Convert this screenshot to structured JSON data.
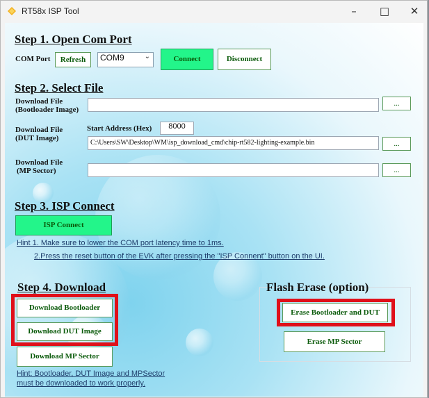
{
  "window": {
    "title": "RT58x ISP Tool"
  },
  "step1": {
    "heading": "Step 1. Open Com Port",
    "com_label": "COM Port",
    "refresh_label": "Refresh",
    "com_value": "COM9",
    "connect_label": "Connect",
    "disconnect_label": "Disconnect"
  },
  "step2": {
    "heading": "Step 2. Select File",
    "bootloader_label_1": "Download File",
    "bootloader_label_2": "(Bootloader Image)",
    "dut_label_1": "Download File",
    "dut_label_2": "(DUT Image)",
    "mp_label_1": "Download File",
    "mp_label_2": "(MP Sector)",
    "start_address_label": "Start Address (Hex)",
    "start_address_value": "8000",
    "bootloader_path": "",
    "dut_path": "C:\\Users\\SW\\Desktop\\WM\\isp_download_cmd\\chip-rt582-lighting-example.bin",
    "mp_path": "",
    "browse_label": "..."
  },
  "step3": {
    "heading": "Step 3. ISP Connect",
    "isp_connect_label": "ISP Connect",
    "hint1": "Hint 1. Make sure to lower the COM port latency time to 1ms.",
    "hint2": "2.Press the reset button of the EVK after pressing the \"ISP Connent\" button on the UI."
  },
  "step4": {
    "heading": "Step 4. Download",
    "bootloader_label": "Download Bootloader",
    "dut_label": "Download DUT Image",
    "mp_label": "Download MP Sector",
    "hint_line1": "Hint:  Bootloader, DUT Image and MPSector",
    "hint_line2": "must be downloaded to work properly."
  },
  "erase": {
    "heading": "Flash Erase (option)",
    "erase_all_label": "Erase Bootloader and DUT",
    "erase_mp_label": "Erase MP Sector"
  },
  "colors": {
    "highlight": "#e0101a",
    "connect_green": "#23f58a",
    "button_text": "#0a5a0a"
  }
}
